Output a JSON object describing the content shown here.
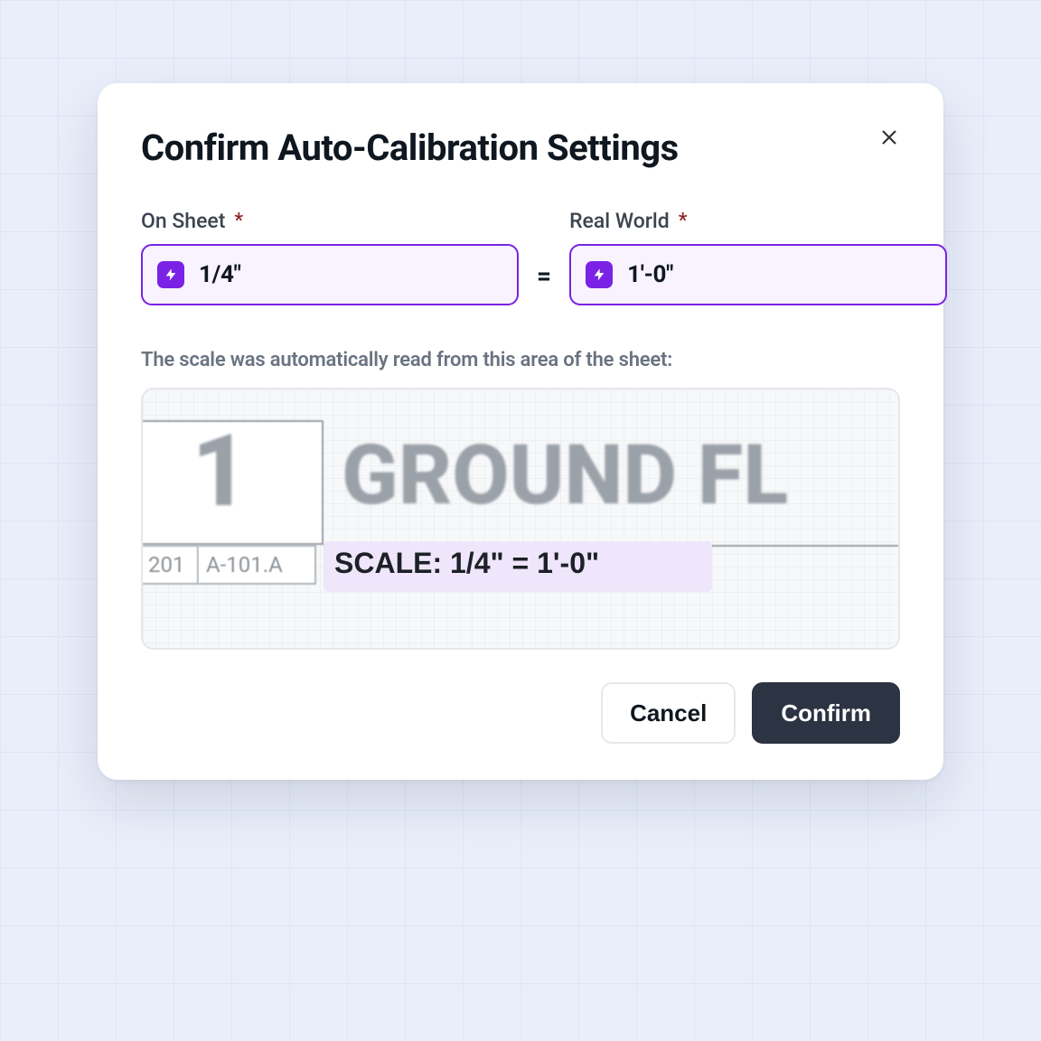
{
  "dialog": {
    "title": "Confirm Auto-Calibration Settings",
    "on_sheet_label": "On Sheet",
    "real_world_label": "Real World",
    "equals": "=",
    "on_sheet_value": "1/4\"",
    "real_world_value": "1'-0\"",
    "caption": "The scale was automatically read from this area of the sheet:",
    "cancel": "Cancel",
    "confirm": "Confirm"
  },
  "preview": {
    "big_number": "1",
    "big_title": "GROUND FL",
    "cell1": "201",
    "cell2": "A-101.A",
    "scale_text": "SCALE:  1/4\" = 1'-0\""
  },
  "icons": {
    "bolt": "bolt-icon",
    "close": "close-icon"
  },
  "colors": {
    "accent": "#7a22e5",
    "btn_dark": "#2c3342"
  }
}
